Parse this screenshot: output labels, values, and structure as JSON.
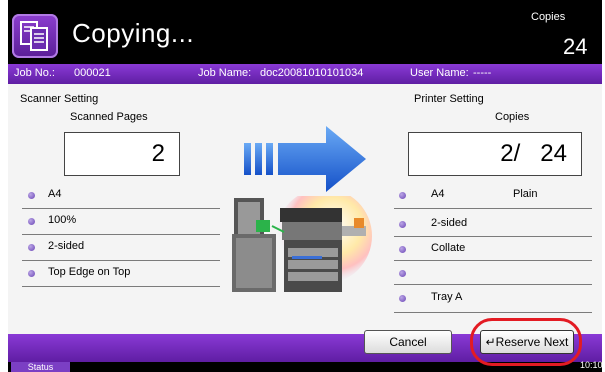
{
  "header": {
    "title": "Copying...",
    "copies_label": "Copies",
    "copies_value": "24"
  },
  "job": {
    "job_no_label": "Job No.:",
    "job_no": "000021",
    "job_name_label": "Job Name:",
    "job_name": "doc20081010101034",
    "user_name_label": "User Name:",
    "user_name": "-----"
  },
  "scanner": {
    "section_label": "Scanner Setting",
    "count_label": "Scanned Pages",
    "count_value": "2",
    "settings": [
      "A4",
      "100%",
      "2-sided",
      "Top Edge on Top"
    ]
  },
  "printer": {
    "section_label": "Printer Setting",
    "count_label": "Copies",
    "count_value": "2/   24",
    "settings": [
      {
        "left": "A4",
        "right": "Plain"
      },
      {
        "left": "2-sided",
        "right": ""
      },
      {
        "left": "Collate",
        "right": ""
      },
      {
        "left": "",
        "right": ""
      },
      {
        "left": "Tray A",
        "right": ""
      }
    ]
  },
  "buttons": {
    "cancel": "Cancel",
    "reserve_next": "Reserve Next"
  },
  "status": {
    "tab_label": "Status",
    "clock": "10:10"
  },
  "colors": {
    "accent": "#7b3fc4",
    "arrow": "#1f6fe0",
    "highlight_ring": "#e31b23"
  }
}
